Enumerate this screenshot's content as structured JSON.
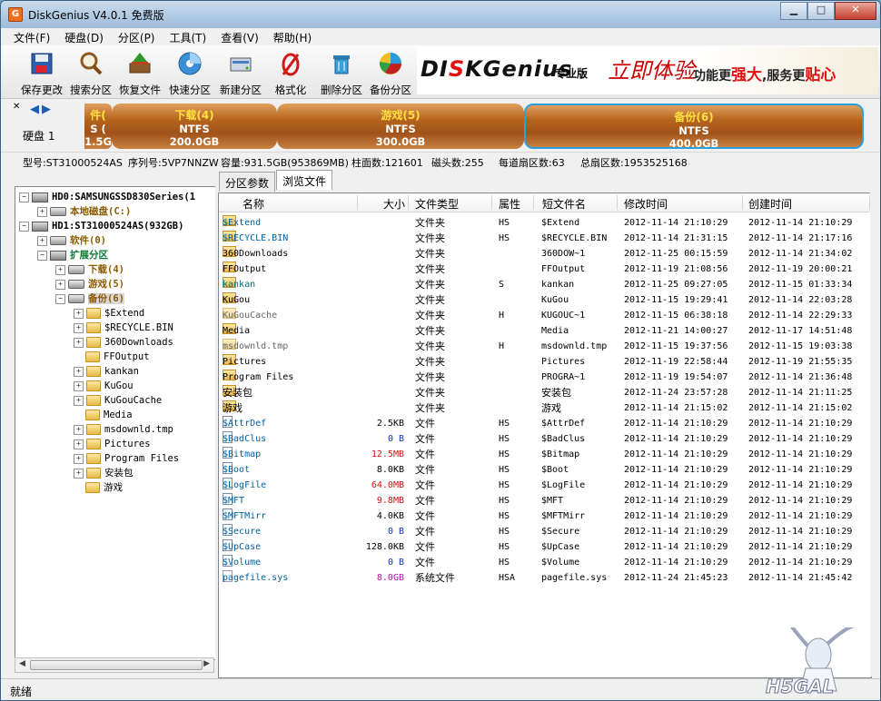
{
  "window": {
    "title": "DiskGenius V4.0.1 免费版",
    "icon_letter": "G"
  },
  "menu": [
    "文件(F)",
    "硬盘(D)",
    "分区(P)",
    "工具(T)",
    "查看(V)",
    "帮助(H)"
  ],
  "toolbar": [
    "保存更改",
    "搜索分区",
    "恢复文件",
    "快速分区",
    "新建分区",
    "格式化",
    "删除分区",
    "备份分区"
  ],
  "banner": {
    "logo_a": "DI",
    "logo_b": "S",
    "logo_c": "KGenius",
    "edition": "专业版",
    "try": "立即体验",
    "slogan_a": "功能更",
    "slogan_b": "强大",
    "slogan_c": ",服务更",
    "slogan_d": "贴心"
  },
  "disk": {
    "label": "硬盘 1",
    "partitions": [
      {
        "name": "件(",
        "fs": "S (",
        "size": "1.5G"
      },
      {
        "name": "下载(4)",
        "fs": "NTFS",
        "size": "200.0GB"
      },
      {
        "name": "游戏(5)",
        "fs": "NTFS",
        "size": "300.0GB"
      },
      {
        "name": "备份(6)",
        "fs": "NTFS",
        "size": "400.0GB"
      }
    ]
  },
  "info": {
    "model": "型号:ST31000524AS",
    "serial": "序列号:5VP7NNZW",
    "capacity": "容量:931.5GB(953869MB)",
    "cylinders": "柱面数:121601",
    "heads": "磁头数:255",
    "sectors": "每道扇区数:63",
    "total": "总扇区数:1953525168"
  },
  "tree": {
    "hd0": "HD0:SAMSUNGSSD830Series(1",
    "local": "本地磁盘(C:)",
    "hd1": "HD1:ST31000524AS(932GB)",
    "soft": "软件(0)",
    "ext": "扩展分区",
    "dl": "下载(4)",
    "game": "游戏(5)",
    "backup": "备份(6)",
    "folders": [
      "$Extend",
      "$RECYCLE.BIN",
      "360Downloads",
      "FFOutput",
      "kankan",
      "KuGou",
      "KuGouCache",
      "Media",
      "msdownld.tmp",
      "Pictures",
      "Program Files",
      "安装包",
      "游戏"
    ]
  },
  "tabs": [
    "分区参数",
    "浏览文件"
  ],
  "columns": [
    "名称",
    "大小",
    "文件类型",
    "属性",
    "短文件名",
    "修改时间",
    "创建时间"
  ],
  "rows": [
    {
      "name": "$Extend",
      "size": "",
      "type": "文件夹",
      "attr": "HS",
      "short": "$Extend",
      "mod": "2012-11-14 21:10:29",
      "created": "2012-11-14 21:10:29"
    },
    {
      "name": "$RECYCLE.BIN",
      "size": "",
      "type": "文件夹",
      "attr": "HS",
      "short": "$RECYCLE.BIN",
      "mod": "2012-11-14 21:31:15",
      "created": "2012-11-14 21:17:16"
    },
    {
      "name": "360Downloads",
      "size": "",
      "type": "文件夹",
      "attr": "",
      "short": "360DOW~1",
      "mod": "2012-11-25 00:15:59",
      "created": "2012-11-14 21:34:02"
    },
    {
      "name": "FFOutput",
      "size": "",
      "type": "文件夹",
      "attr": "",
      "short": "FFOutput",
      "mod": "2012-11-19 21:08:56",
      "created": "2012-11-19 20:00:21"
    },
    {
      "name": "kankan",
      "size": "",
      "type": "文件夹",
      "attr": "S",
      "short": "kankan",
      "mod": "2012-11-25 09:27:05",
      "created": "2012-11-15 01:33:34"
    },
    {
      "name": "KuGou",
      "size": "",
      "type": "文件夹",
      "attr": "",
      "short": "KuGou",
      "mod": "2012-11-15 19:29:41",
      "created": "2012-11-14 22:03:28"
    },
    {
      "name": "KuGouCache",
      "size": "",
      "type": "文件夹",
      "attr": "H",
      "short": "KUGOUC~1",
      "mod": "2012-11-15 06:38:18",
      "created": "2012-11-14 22:29:33"
    },
    {
      "name": "Media",
      "size": "",
      "type": "文件夹",
      "attr": "",
      "short": "Media",
      "mod": "2012-11-21 14:00:27",
      "created": "2012-11-17 14:51:48"
    },
    {
      "name": "msdownld.tmp",
      "size": "",
      "type": "文件夹",
      "attr": "H",
      "short": "msdownld.tmp",
      "mod": "2012-11-15 19:37:56",
      "created": "2012-11-15 19:03:38"
    },
    {
      "name": "Pictures",
      "size": "",
      "type": "文件夹",
      "attr": "",
      "short": "Pictures",
      "mod": "2012-11-19 22:58:44",
      "created": "2012-11-19 21:55:35"
    },
    {
      "name": "Program Files",
      "size": "",
      "type": "文件夹",
      "attr": "",
      "short": "PROGRA~1",
      "mod": "2012-11-19 19:54:07",
      "created": "2012-11-14 21:36:48"
    },
    {
      "name": "安装包",
      "size": "",
      "type": "文件夹",
      "attr": "",
      "short": "安装包",
      "mod": "2012-11-24 23:57:28",
      "created": "2012-11-14 21:11:25"
    },
    {
      "name": "游戏",
      "size": "",
      "type": "文件夹",
      "attr": "",
      "short": "游戏",
      "mod": "2012-11-14 21:15:02",
      "created": "2012-11-14 21:15:02"
    },
    {
      "name": "$AttrDef",
      "size": "2.5KB",
      "type": "文件",
      "attr": "HS",
      "short": "$AttrDef",
      "mod": "2012-11-14 21:10:29",
      "created": "2012-11-14 21:10:29"
    },
    {
      "name": "$BadClus",
      "size": "0 B",
      "type": "文件",
      "attr": "HS",
      "short": "$BadClus",
      "mod": "2012-11-14 21:10:29",
      "created": "2012-11-14 21:10:29"
    },
    {
      "name": "$Bitmap",
      "size": "12.5MB",
      "type": "文件",
      "attr": "HS",
      "short": "$Bitmap",
      "mod": "2012-11-14 21:10:29",
      "created": "2012-11-14 21:10:29"
    },
    {
      "name": "$Boot",
      "size": "8.0KB",
      "type": "文件",
      "attr": "HS",
      "short": "$Boot",
      "mod": "2012-11-14 21:10:29",
      "created": "2012-11-14 21:10:29"
    },
    {
      "name": "$LogFile",
      "size": "64.0MB",
      "type": "文件",
      "attr": "HS",
      "short": "$LogFile",
      "mod": "2012-11-14 21:10:29",
      "created": "2012-11-14 21:10:29"
    },
    {
      "name": "$MFT",
      "size": "9.8MB",
      "type": "文件",
      "attr": "HS",
      "short": "$MFT",
      "mod": "2012-11-14 21:10:29",
      "created": "2012-11-14 21:10:29"
    },
    {
      "name": "$MFTMirr",
      "size": "4.0KB",
      "type": "文件",
      "attr": "HS",
      "short": "$MFTMirr",
      "mod": "2012-11-14 21:10:29",
      "created": "2012-11-14 21:10:29"
    },
    {
      "name": "$Secure",
      "size": "0 B",
      "type": "文件",
      "attr": "HS",
      "short": "$Secure",
      "mod": "2012-11-14 21:10:29",
      "created": "2012-11-14 21:10:29"
    },
    {
      "name": "$UpCase",
      "size": "128.0KB",
      "type": "文件",
      "attr": "HS",
      "short": "$UpCase",
      "mod": "2012-11-14 21:10:29",
      "created": "2012-11-14 21:10:29"
    },
    {
      "name": "$Volume",
      "size": "0 B",
      "type": "文件",
      "attr": "HS",
      "short": "$Volume",
      "mod": "2012-11-14 21:10:29",
      "created": "2012-11-14 21:10:29"
    },
    {
      "name": "pagefile.sys",
      "size": "8.0GB",
      "type": "系统文件",
      "attr": "HSA",
      "short": "pagefile.sys",
      "mod": "2012-11-24 21:45:23",
      "created": "2012-11-14 21:45:42"
    }
  ],
  "status": "就绪"
}
